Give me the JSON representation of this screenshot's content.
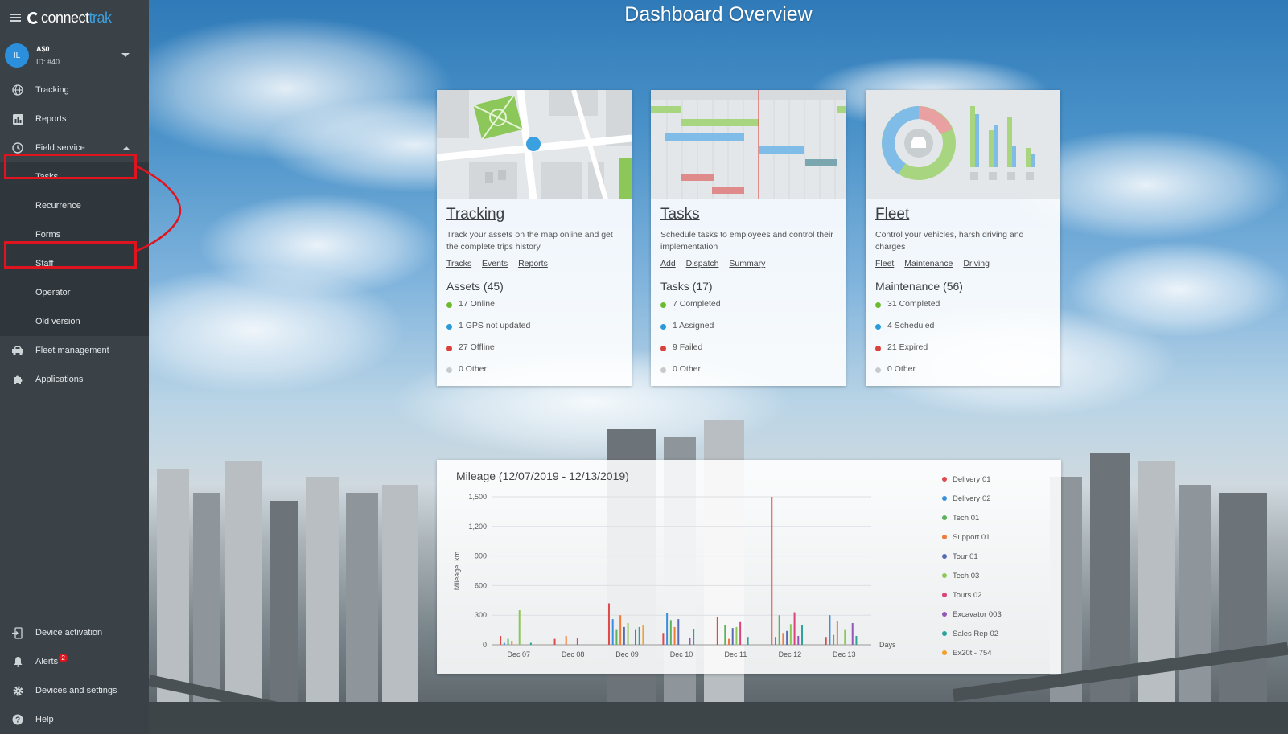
{
  "app": {
    "logo_main": "connect",
    "logo_accent": "trak",
    "page_title": "Dashboard Overview"
  },
  "user": {
    "initials": "IL",
    "name": "A$0",
    "id": "ID: #40"
  },
  "sidebar": {
    "items": [
      {
        "label": "Tracking",
        "icon": "globe-icon"
      },
      {
        "label": "Reports",
        "icon": "chart-icon"
      },
      {
        "label": "Field service",
        "icon": "clock-icon"
      }
    ],
    "field_service_children": [
      "Tasks",
      "Recurrence",
      "Forms",
      "Staff",
      "Operator",
      "Old version"
    ],
    "items_after": [
      {
        "label": "Fleet management",
        "icon": "car-icon"
      },
      {
        "label": "Applications",
        "icon": "puzzle-icon"
      }
    ],
    "bottom": [
      {
        "label": "Device activation",
        "icon": "device-activation-icon"
      },
      {
        "label": "Alerts",
        "icon": "bell-icon",
        "badge": "2"
      },
      {
        "label": "Devices and settings",
        "icon": "gear-icon"
      },
      {
        "label": "Help",
        "icon": "help-icon"
      }
    ]
  },
  "colors": {
    "online": "#6cbb2f",
    "notupdated": "#2b9ad8",
    "offline": "#d9413a",
    "other": "#c8cbcd",
    "highlight": "#e0141e"
  },
  "cards": [
    {
      "title": "Tracking",
      "desc": "Track your assets on the map online and get the complete trips history",
      "links": [
        "Tracks",
        "Events",
        "Reports"
      ],
      "stat_title": "Assets (45)",
      "stats": [
        "17 Online",
        "1 GPS not updated",
        "27 Offline",
        "0 Other"
      ]
    },
    {
      "title": "Tasks",
      "desc": "Schedule tasks to employees and control their implementation",
      "links": [
        "Add",
        "Dispatch",
        "Summary"
      ],
      "stat_title": "Tasks (17)",
      "stats": [
        "7 Completed",
        "1 Assigned",
        "9 Failed",
        "0 Other"
      ]
    },
    {
      "title": "Fleet",
      "desc": "Control your vehicles, harsh driving and charges",
      "links": [
        "Fleet",
        "Maintenance",
        "Driving"
      ],
      "stat_title": "Maintenance (56)",
      "stats": [
        "31 Completed",
        "4 Scheduled",
        "21 Expired",
        "0 Other"
      ]
    }
  ],
  "chart_data": {
    "type": "bar",
    "title": "Mileage (12/07/2019 - 12/13/2019)",
    "xlabel": "Days",
    "ylabel": "Mileage, km",
    "ylim": [
      0,
      1500
    ],
    "yticks": [
      "0",
      "300",
      "600",
      "900",
      "1,200",
      "1,500"
    ],
    "categories": [
      "Dec 07",
      "Dec 08",
      "Dec 09",
      "Dec 10",
      "Dec 11",
      "Dec 12",
      "Dec 13"
    ],
    "grid": true,
    "legend_position": "right",
    "series": [
      {
        "name": "Delivery 01",
        "color": "#e0494a",
        "values": [
          90,
          60,
          420,
          120,
          280,
          1500,
          80
        ]
      },
      {
        "name": "Delivery 02",
        "color": "#3a8fe0",
        "values": [
          20,
          0,
          260,
          320,
          0,
          80,
          300
        ]
      },
      {
        "name": "Tech 01",
        "color": "#5cb35c",
        "values": [
          60,
          0,
          150,
          250,
          200,
          300,
          100
        ]
      },
      {
        "name": "Support 01",
        "color": "#f07a3a",
        "values": [
          40,
          90,
          300,
          180,
          60,
          120,
          240
        ]
      },
      {
        "name": "Tour 01",
        "color": "#5a6bb5",
        "values": [
          0,
          0,
          180,
          260,
          170,
          140,
          0
        ]
      },
      {
        "name": "Tech 03",
        "color": "#8cc759",
        "values": [
          350,
          0,
          220,
          0,
          180,
          210,
          150
        ]
      },
      {
        "name": "Tours 02",
        "color": "#d9447a",
        "values": [
          0,
          70,
          0,
          0,
          230,
          330,
          0
        ]
      },
      {
        "name": "Excavator 003",
        "color": "#9457b8",
        "values": [
          0,
          0,
          150,
          70,
          0,
          90,
          220
        ]
      },
      {
        "name": "Sales Rep 02",
        "color": "#2ba39a",
        "values": [
          20,
          0,
          180,
          160,
          80,
          200,
          90
        ]
      },
      {
        "name": "Ex20t - 754",
        "color": "#f0a030",
        "values": [
          0,
          0,
          200,
          0,
          0,
          0,
          0
        ]
      }
    ]
  }
}
